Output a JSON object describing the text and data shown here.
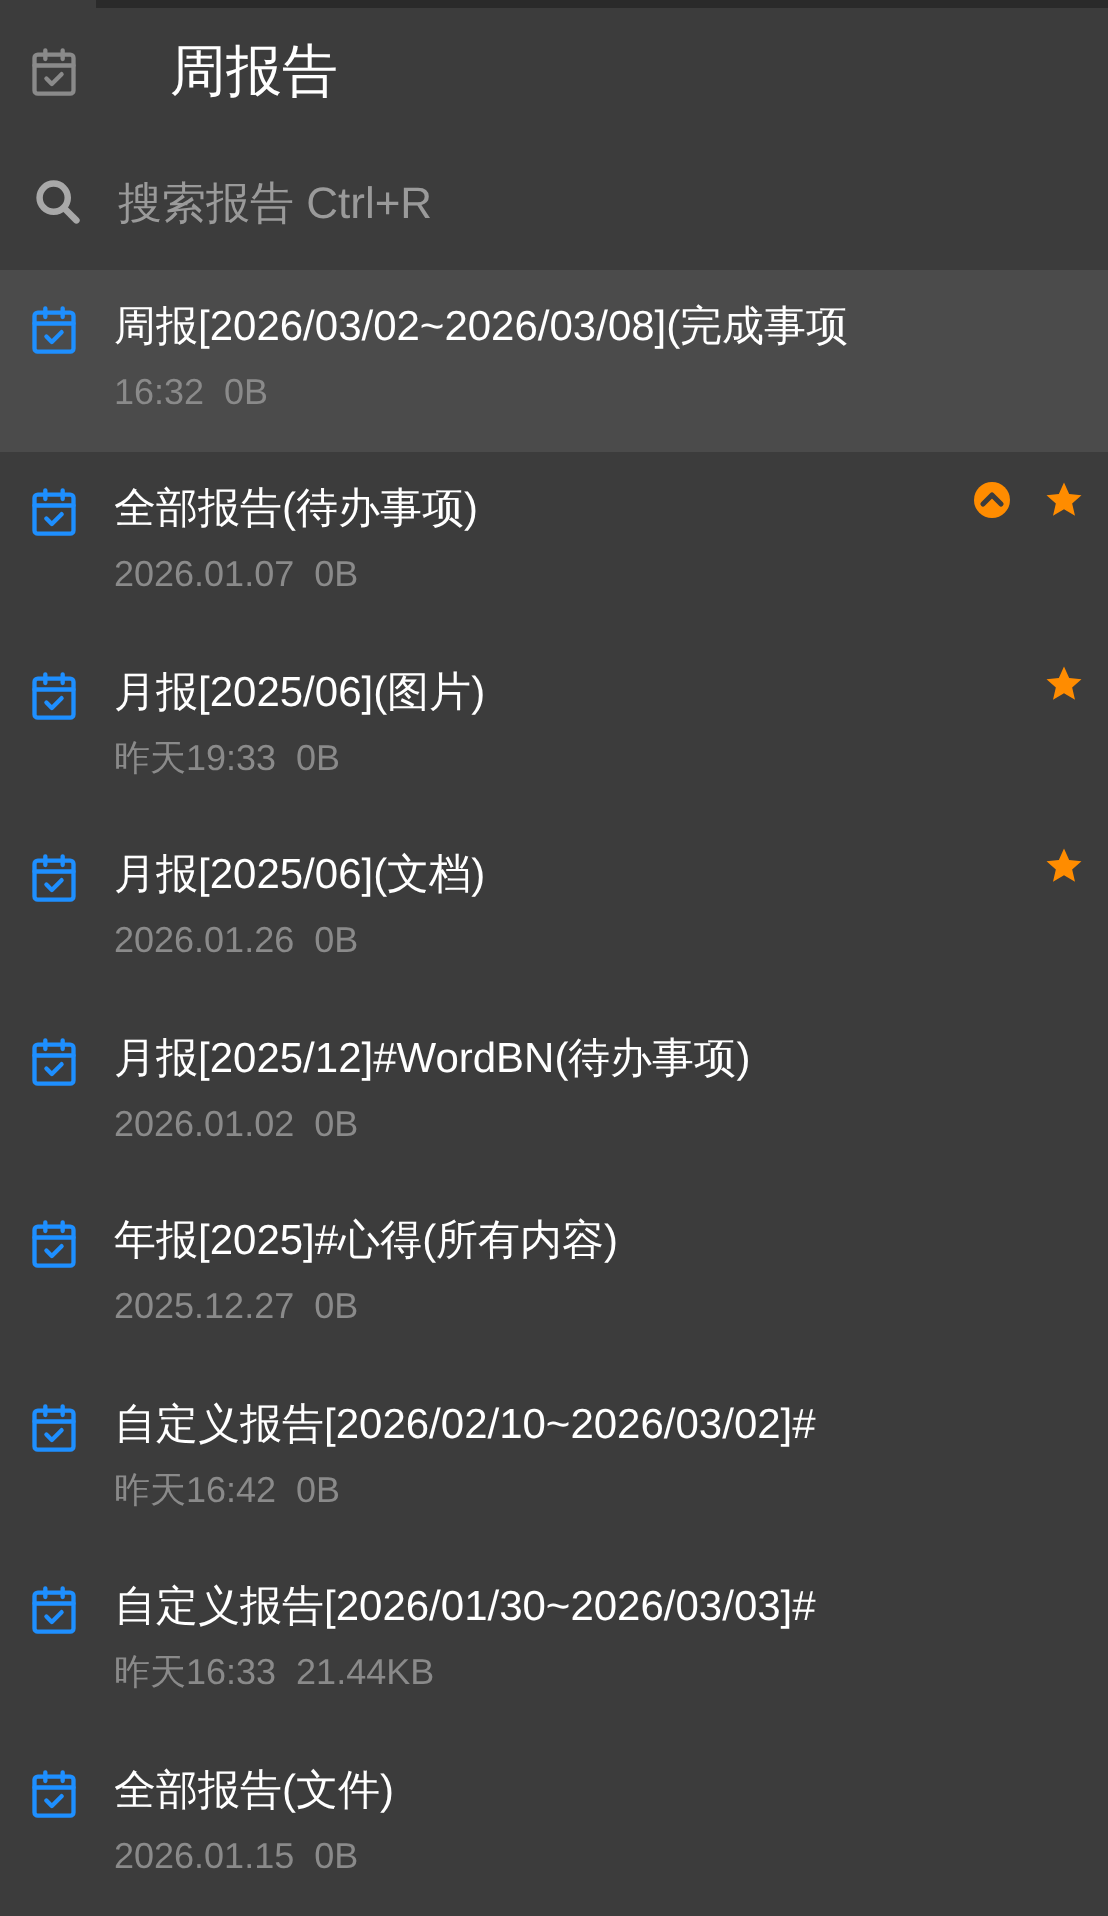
{
  "header": {
    "title": "周报告"
  },
  "search": {
    "placeholder": "搜索报告 Ctrl+R"
  },
  "reports": [
    {
      "title": "周报[2026/03/02~2026/03/08](完成事项",
      "time": "16:32",
      "size": "0B",
      "selected": true,
      "pinned": false,
      "starred": false
    },
    {
      "title": "全部报告(待办事项)",
      "time": "2026.01.07",
      "size": "0B",
      "selected": false,
      "pinned": true,
      "starred": true
    },
    {
      "title": "月报[2025/06](图片)",
      "time": "昨天19:33",
      "size": "0B",
      "selected": false,
      "pinned": false,
      "starred": true
    },
    {
      "title": "月报[2025/06](文档)",
      "time": "2026.01.26",
      "size": "0B",
      "selected": false,
      "pinned": false,
      "starred": true
    },
    {
      "title": "月报[2025/12]#WordBN(待办事项)",
      "time": "2026.01.02",
      "size": "0B",
      "selected": false,
      "pinned": false,
      "starred": false
    },
    {
      "title": "年报[2025]#心得(所有内容)",
      "time": "2025.12.27",
      "size": "0B",
      "selected": false,
      "pinned": false,
      "starred": false
    },
    {
      "title": "自定义报告[2026/02/10~2026/03/02]#",
      "time": "昨天16:42",
      "size": "0B",
      "selected": false,
      "pinned": false,
      "starred": false
    },
    {
      "title": "自定义报告[2026/01/30~2026/03/03]#",
      "time": "昨天16:33",
      "size": "21.44KB",
      "selected": false,
      "pinned": false,
      "starred": false
    },
    {
      "title": "全部报告(文件)",
      "time": "2026.01.15",
      "size": "0B",
      "selected": false,
      "pinned": false,
      "starred": false
    }
  ]
}
